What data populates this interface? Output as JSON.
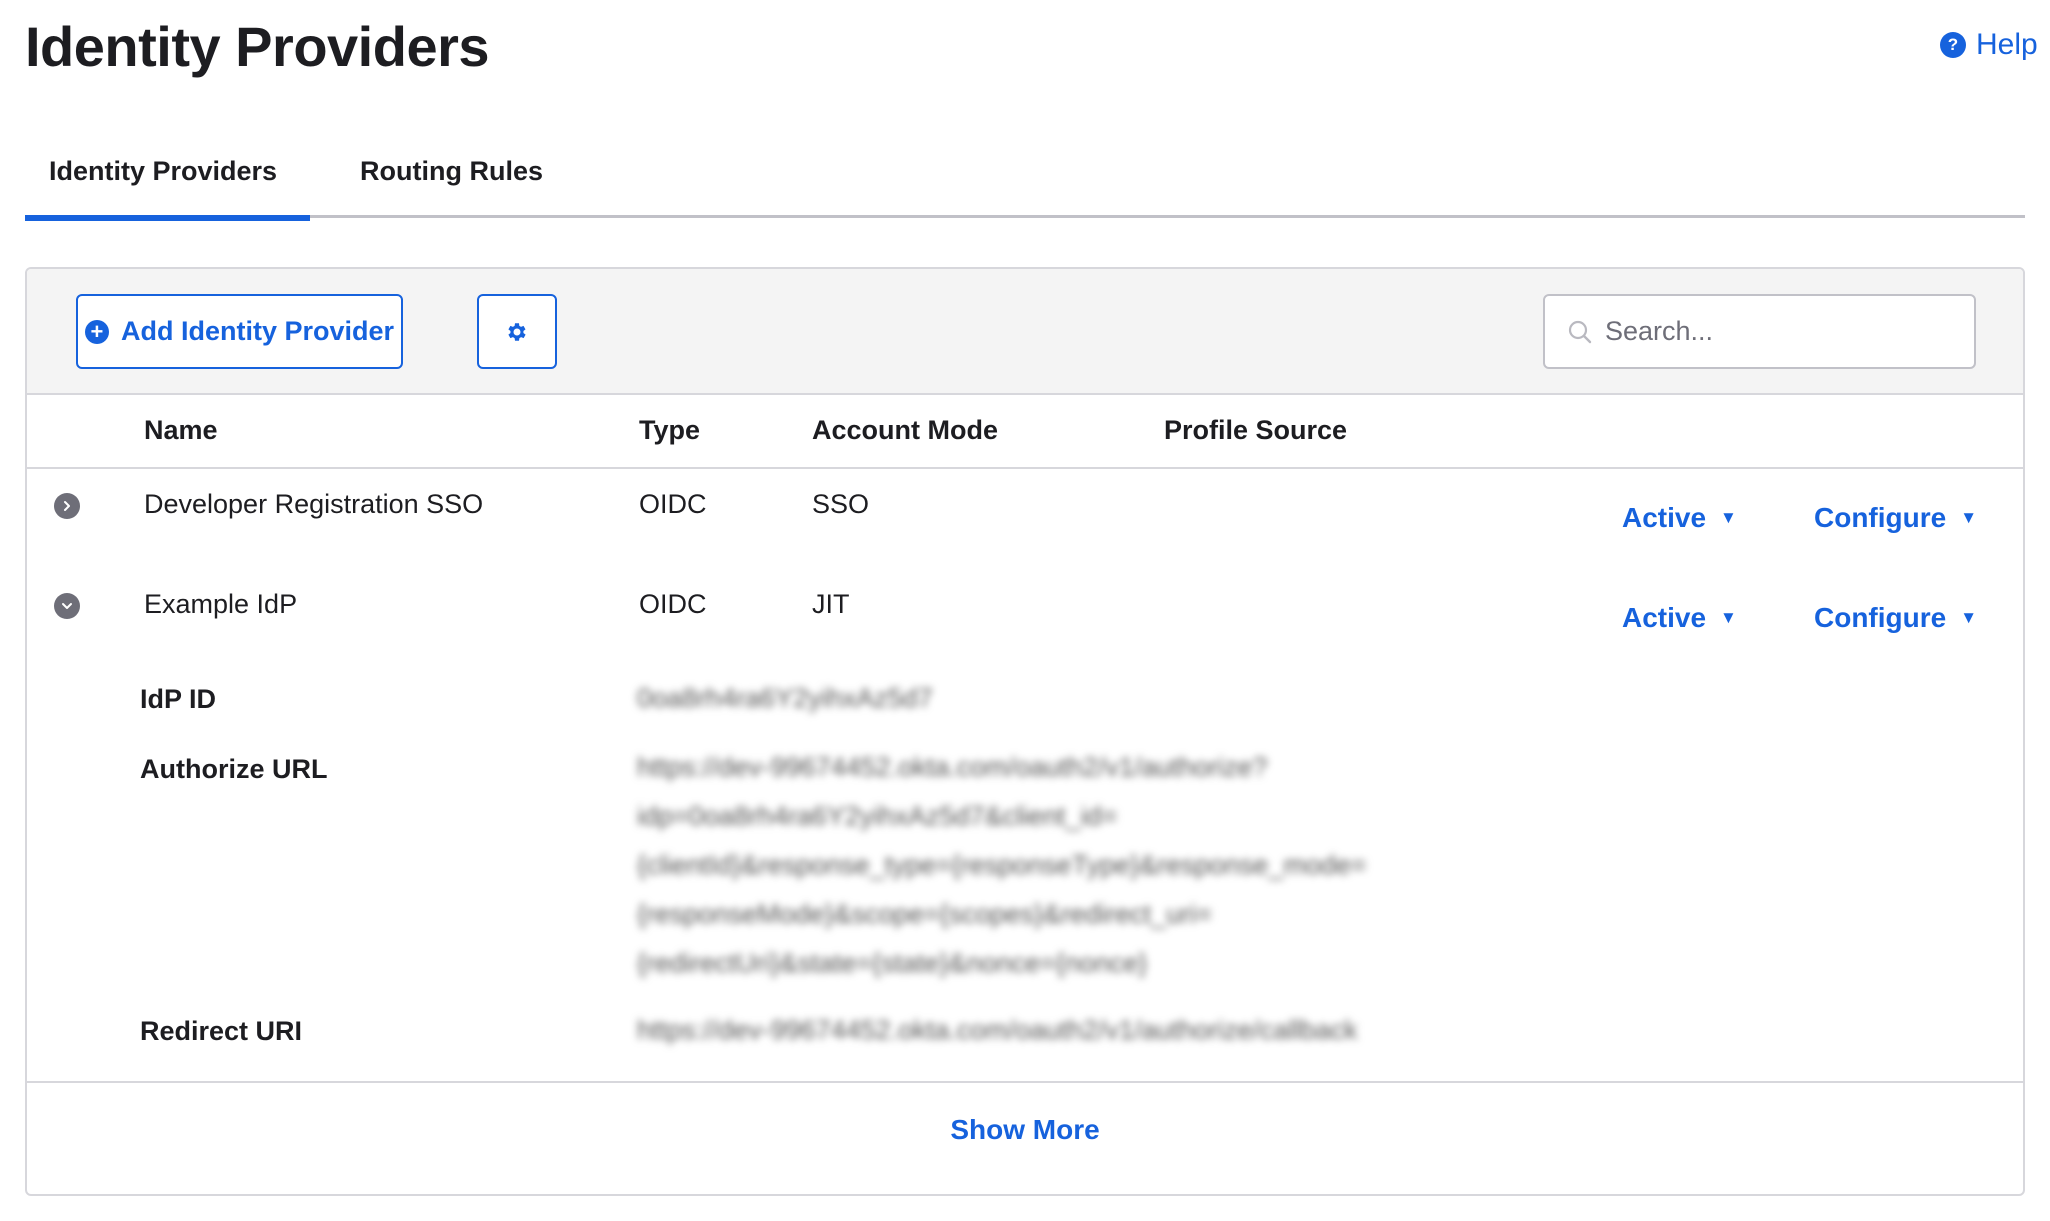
{
  "page": {
    "title": "Identity Providers",
    "help_label": "Help",
    "help_icon": "question-circle-icon"
  },
  "tabs": [
    {
      "label": "Identity Providers",
      "active": true
    },
    {
      "label": "Routing Rules",
      "active": false
    }
  ],
  "toolbar": {
    "add_label": "Add Identity Provider",
    "add_icon": "plus-circle-icon",
    "settings_icon": "gear-icon",
    "search_placeholder": "Search...",
    "search_value": ""
  },
  "table": {
    "columns": [
      "Name",
      "Type",
      "Account Mode",
      "Profile Source"
    ],
    "rows": [
      {
        "name": "Developer Registration SSO",
        "type": "OIDC",
        "account_mode": "SSO",
        "profile_source": "",
        "status": "Active",
        "configure": "Configure",
        "expanded": false
      },
      {
        "name": "Example IdP",
        "type": "OIDC",
        "account_mode": "JIT",
        "profile_source": "",
        "status": "Active",
        "configure": "Configure",
        "expanded": true
      }
    ],
    "details": {
      "idp_id_label": "IdP ID",
      "idp_id_value": "0oa8rh4ra6Y2yihxAz5d7",
      "authorize_url_label": "Authorize URL",
      "authorize_url_lines": [
        "https://dev-99674452.okta.com/oauth2/v1/authorize?",
        "idp=0oa8rh4ra6Y2yihxAz5d7&client_id=",
        "{clientId}&response_type={responseType}&response_mode=",
        "{responseMode}&scope={scopes}&redirect_uri=",
        "{redirectUri}&state={state}&nonce={nonce}"
      ],
      "redirect_uri_label": "Redirect URI",
      "redirect_uri_value": "https://dev-99674452.okta.com/oauth2/v1/authorize/callback",
      "values_blurred": true
    },
    "show_more_label": "Show More"
  },
  "colors": {
    "accent": "#1662dd",
    "text": "#1d1d21",
    "icon_gray": "#6e6e78",
    "border": "#d7d7dc",
    "toolbar_bg": "#f4f4f4"
  }
}
